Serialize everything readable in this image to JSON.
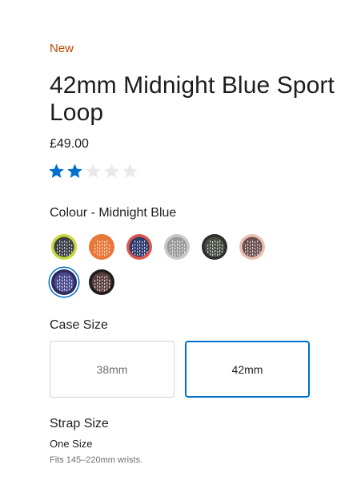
{
  "product": {
    "badge": "New",
    "title": "42mm Midnight Blue Sport Loop",
    "price": "£49.00",
    "rating": {
      "value": 2,
      "max": 5,
      "filled_color": "#0070c9",
      "empty_color": "#e8e8ed"
    }
  },
  "colour": {
    "label": "Colour - Midnight Blue",
    "swatches": [
      {
        "name": "lime",
        "ring": "#c8d63a",
        "weave": "#3a3d44",
        "selected": false
      },
      {
        "name": "orange",
        "ring": "#e8783a",
        "weave": "#e8783a",
        "selected": false
      },
      {
        "name": "red-navy",
        "ring": "#e0574b",
        "weave": "#2c3a6e",
        "selected": false
      },
      {
        "name": "grey",
        "ring": "#c9c9c9",
        "weave": "#9a9a9a",
        "selected": false
      },
      {
        "name": "charcoal",
        "ring": "#2e2f2a",
        "weave": "#4a4d46",
        "selected": false
      },
      {
        "name": "pink-sand",
        "ring": "#e9bfb0",
        "weave": "#6b5050",
        "selected": false
      },
      {
        "name": "midnight-blue",
        "ring": "#2b2a5e",
        "weave": "#4b4b8f",
        "selected": true
      },
      {
        "name": "black",
        "ring": "#1d1b1c",
        "weave": "#5a3d3d",
        "selected": false
      }
    ]
  },
  "case_size": {
    "label": "Case Size",
    "options": [
      {
        "label": "38mm",
        "selected": false
      },
      {
        "label": "42mm",
        "selected": true
      }
    ]
  },
  "strap_size": {
    "label": "Strap Size",
    "value": "One Size",
    "note": "Fits 145–220mm wrists."
  }
}
